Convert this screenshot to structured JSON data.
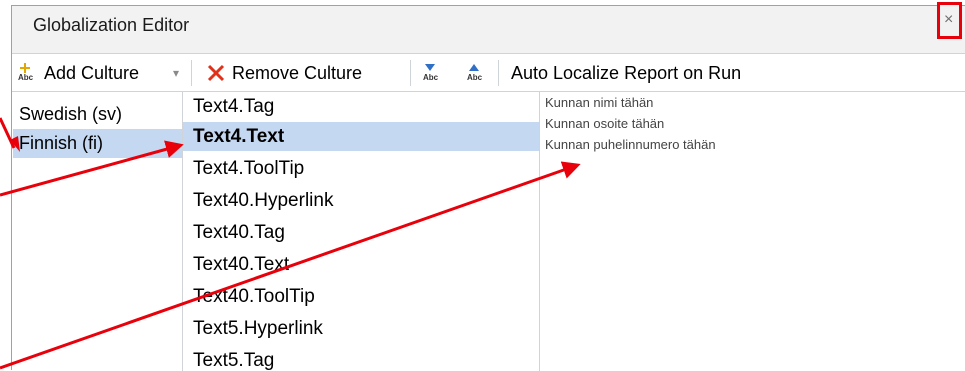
{
  "window": {
    "title": "Globalization Editor",
    "close_glyph": "×"
  },
  "toolbar": {
    "add_culture_label": "Add Culture",
    "add_culture_icon": "add-abc-icon",
    "dropdown_caret": "▾",
    "remove_culture_label": "Remove Culture",
    "remove_culture_icon": "red-x-icon",
    "move_down_icon_text": "Abc",
    "move_up_icon_text": "Abc",
    "auto_localize_label": "Auto Localize Report on Run"
  },
  "cultures": [
    {
      "label": "Swedish (sv)",
      "selected": false
    },
    {
      "label": "Finnish (fi)",
      "selected": true
    }
  ],
  "resources": [
    {
      "label": "Text4.Tag",
      "selected": false
    },
    {
      "label": "Text4.Text",
      "selected": true
    },
    {
      "label": "Text4.ToolTip",
      "selected": false
    },
    {
      "label": "Text40.Hyperlink",
      "selected": false
    },
    {
      "label": "Text40.Tag",
      "selected": false
    },
    {
      "label": "Text40.Text",
      "selected": false
    },
    {
      "label": "Text40.ToolTip",
      "selected": false
    },
    {
      "label": "Text5.Hyperlink",
      "selected": false
    },
    {
      "label": "Text5.Tag",
      "selected": false
    }
  ],
  "value_lines": [
    "Kunnan nimi tähän",
    "Kunnan osoite tähän",
    "Kunnan puhelinnumero tähän"
  ],
  "colors": {
    "selection": "#c5d8f1",
    "annotation": "#e8000b"
  }
}
